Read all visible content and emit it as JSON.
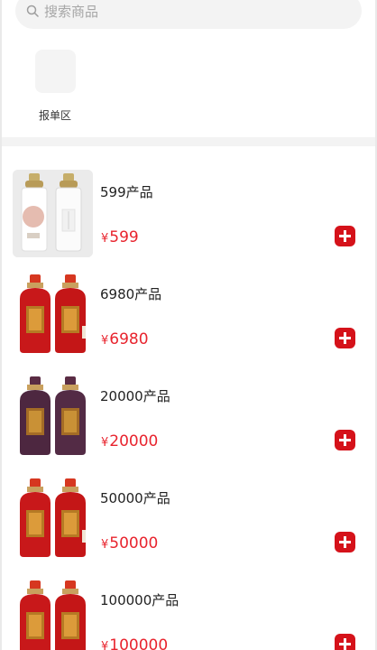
{
  "search": {
    "placeholder": "搜索商品",
    "icon": "search-icon"
  },
  "quick_entries": [
    {
      "label": "报单区",
      "icon": "blank-tile-icon"
    }
  ],
  "products": [
    {
      "name": "599产品",
      "currency": "¥",
      "price": "599",
      "image": "clear-glass-bottles"
    },
    {
      "name": "6980产品",
      "currency": "¥",
      "price": "6980",
      "image": "red-bottles"
    },
    {
      "name": "20000产品",
      "currency": "¥",
      "price": "20000",
      "image": "purple-bottles"
    },
    {
      "name": "50000产品",
      "currency": "¥",
      "price": "50000",
      "image": "red-bottles"
    },
    {
      "name": "100000产品",
      "currency": "¥",
      "price": "100000",
      "image": "red-bottles"
    }
  ],
  "colors": {
    "accent": "#d5121a",
    "price": "#e8242e",
    "search_bg": "#f3f3f3"
  }
}
